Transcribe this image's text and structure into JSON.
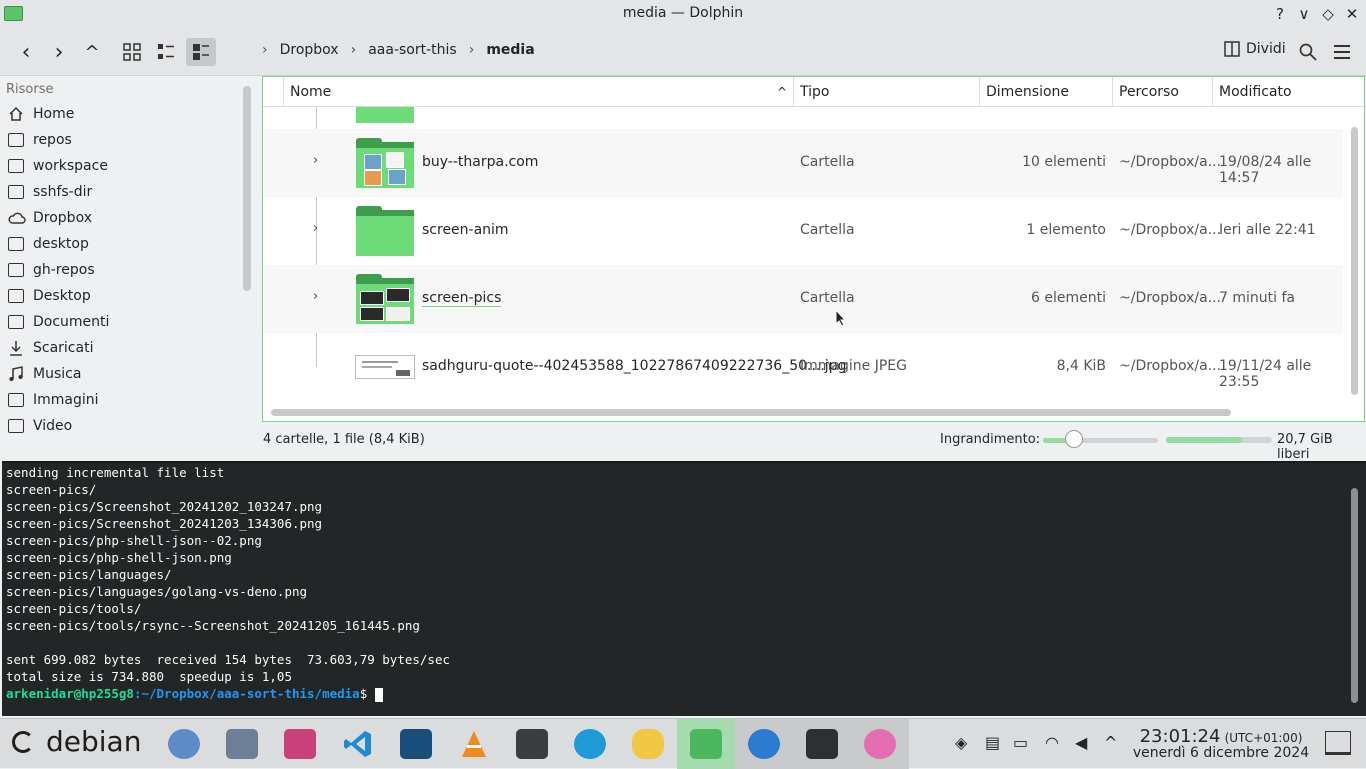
{
  "window": {
    "title": "media — Dolphin",
    "buttons": [
      "?",
      "∨",
      "◇",
      "✕"
    ]
  },
  "toolbar": {
    "back": "‹",
    "forward": "›",
    "up": "^",
    "breadcrumb": [
      "Dropbox",
      "aaa-sort-this",
      "media"
    ],
    "split_label": "Dividi"
  },
  "sidebar": {
    "section": "Risorse",
    "items": [
      {
        "label": "Home",
        "icon": "home-icon"
      },
      {
        "label": "repos",
        "icon": "folder-icon"
      },
      {
        "label": "workspace",
        "icon": "folder-icon"
      },
      {
        "label": "sshfs-dir",
        "icon": "folder-icon"
      },
      {
        "label": "Dropbox",
        "icon": "cloud-icon"
      },
      {
        "label": "desktop",
        "icon": "monitor-icon"
      },
      {
        "label": "gh-repos",
        "icon": "folder-icon"
      },
      {
        "label": "Desktop",
        "icon": "monitor-icon"
      },
      {
        "label": "Documenti",
        "icon": "document-icon"
      },
      {
        "label": "Scaricati",
        "icon": "download-icon"
      },
      {
        "label": "Musica",
        "icon": "music-icon"
      },
      {
        "label": "Immagini",
        "icon": "image-icon"
      },
      {
        "label": "Video",
        "icon": "video-icon"
      }
    ]
  },
  "columns": [
    "Nome",
    "Tipo",
    "Dimensione",
    "Percorso",
    "Modificato"
  ],
  "rows": [
    {
      "name": "buy--tharpa.com",
      "type": "Cartella",
      "size": "10 elementi",
      "path": "~/Dropbox/a...",
      "modified": "19/08/24 alle 14:57"
    },
    {
      "name": "screen-anim",
      "type": "Cartella",
      "size": "1 elemento",
      "path": "~/Dropbox/a...",
      "modified": "Ieri alle 22:41"
    },
    {
      "name": "screen-pics",
      "type": "Cartella",
      "size": "6 elementi",
      "path": "~/Dropbox/a...",
      "modified": "7 minuti fa"
    },
    {
      "name": "sadhguru-quote--402453588_10227867409222736_50....jpg",
      "type": "Immagine JPEG",
      "size": "8,4 KiB",
      "path": "~/Dropbox/a...",
      "modified": "19/11/24 alle 23:55"
    }
  ],
  "statusbar": {
    "info": "4 cartelle, 1 file (8,4 KiB)",
    "zoom_label": "Ingrandimento:",
    "zoom_level": 0.29,
    "free_space": "20,7 GiB liberi",
    "disk_used_fraction": 0.72
  },
  "terminal": {
    "lines": [
      "sending incremental file list",
      "screen-pics/",
      "screen-pics/Screenshot_20241202_103247.png",
      "screen-pics/Screenshot_20241203_134306.png",
      "screen-pics/php-shell-json--02.png",
      "screen-pics/php-shell-json.png",
      "screen-pics/languages/",
      "screen-pics/languages/golang-vs-deno.png",
      "screen-pics/tools/",
      "screen-pics/tools/rsync--Screenshot_20241205_161445.png",
      "",
      "sent 699.082 bytes  received 154 bytes  73.603,79 bytes/sec",
      "total size is 734.880  speedup is 1,05"
    ],
    "prompt_user": "arkenidar@hp255g8",
    "prompt_path": ":~/Dropbox/aaa-sort-this/media",
    "prompt_symbol": "$ "
  },
  "taskbar": {
    "launcher": "debian",
    "time": "23:01:24",
    "timezone": "(UTC+01:00)",
    "date": "venerdì 6 dicembre 2024"
  }
}
